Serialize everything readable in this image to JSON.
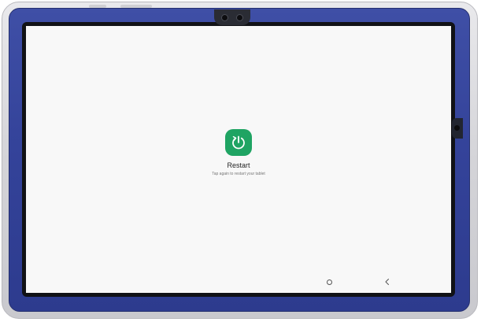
{
  "screen": {
    "restart": {
      "label": "Restart",
      "hint": "Tap again to restart your tablet",
      "icon": "restart-power-icon",
      "color": "#1fa463"
    },
    "navigation": {
      "home_icon": "home-circle-icon",
      "back_icon": "chevron-left-icon"
    }
  },
  "device": {
    "case_color": "#34439a",
    "bumper_color": "#d4d4d8",
    "screen_color": "#f8f8f8"
  }
}
